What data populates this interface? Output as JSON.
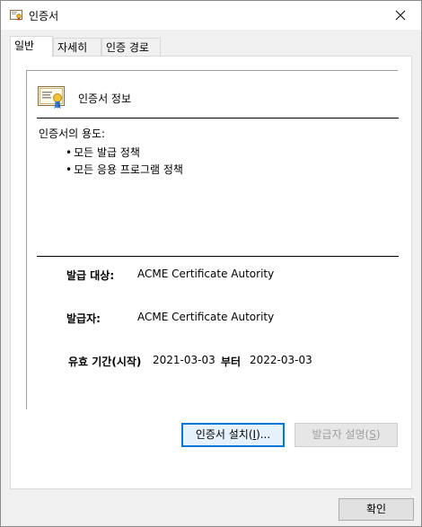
{
  "window": {
    "title": "인증서"
  },
  "tabs": [
    {
      "label": "일반"
    },
    {
      "label": "자세히"
    },
    {
      "label": "인증 경로"
    }
  ],
  "cert": {
    "heading": "인증서 정보",
    "purpose_title": "인증서의 용도:",
    "purposes": [
      "모든 발급 정책",
      "모든 응용 프로그램 정책"
    ],
    "issued_to_label": "발급 대상:",
    "issued_to_value": "ACME Certificate Autority",
    "issued_by_label": "발급자:",
    "issued_by_value": "ACME Certificate Autority",
    "validity_label": "유효 기간(시작)",
    "valid_from": "2021-03-03",
    "valid_to_label": "부터",
    "valid_to": "2022-03-03"
  },
  "buttons": {
    "install_prefix": "인증서 설치(",
    "install_key": "I",
    "install_suffix": ")...",
    "statement_prefix": "발급자 설명(",
    "statement_key": "S",
    "statement_suffix": ")",
    "ok": "확인"
  },
  "icons": {
    "title": "certificate-icon",
    "close": "close-icon",
    "cert": "certificate-ribbon-icon"
  }
}
